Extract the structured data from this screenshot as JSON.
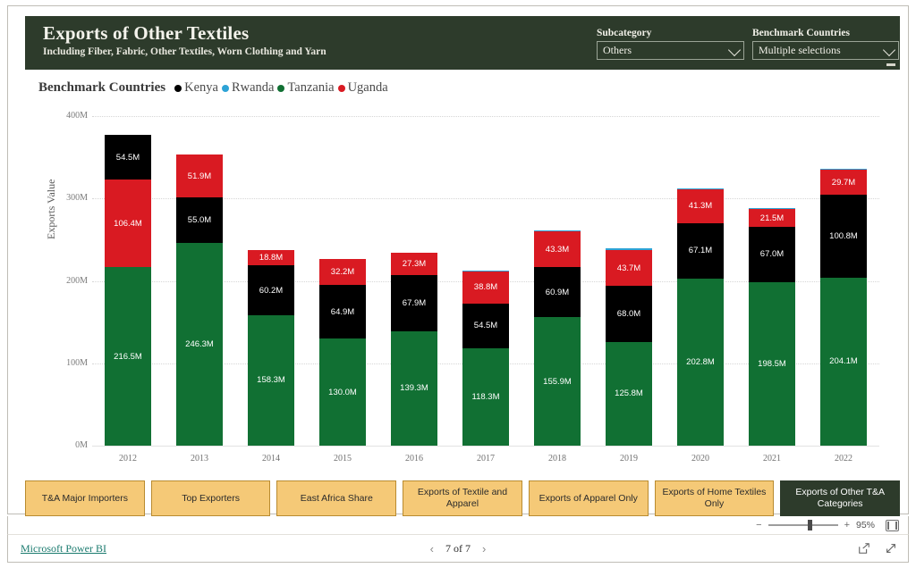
{
  "header": {
    "title": "Exports of Other Textiles",
    "subtitle": "Including Fiber, Fabric, Other Textiles, Worn Clothing and Yarn",
    "background_color": "#2d3b2b",
    "slicers": [
      {
        "label": "Subcategory",
        "value": "Others",
        "chevron": "chevron-down-icon"
      },
      {
        "label": "Benchmark Countries",
        "value": "Multiple selections",
        "chevron": "chevron-down-icon"
      }
    ]
  },
  "legend": {
    "title": "Benchmark Countries",
    "items": [
      {
        "label": "Kenya",
        "color": "#000000"
      },
      {
        "label": "Rwanda",
        "color": "#2da3d6"
      },
      {
        "label": "Tanzania",
        "color": "#117033"
      },
      {
        "label": "Uganda",
        "color": "#d91a22"
      }
    ]
  },
  "chart_data": {
    "type": "bar",
    "stacked": true,
    "title": "Exports of Other Textiles",
    "xlabel": "",
    "ylabel": "Exports Value",
    "ylim": [
      0,
      400
    ],
    "yunit": "M",
    "ytick_labels": [
      "0M",
      "100M",
      "200M",
      "300M",
      "400M"
    ],
    "ytick_values": [
      0,
      100,
      200,
      300,
      400
    ],
    "grid": true,
    "legend_position": "top-left",
    "categories": [
      "2012",
      "2013",
      "2014",
      "2015",
      "2016",
      "2017",
      "2018",
      "2019",
      "2020",
      "2021",
      "2022"
    ],
    "series": [
      {
        "name": "Tanzania",
        "color": "#117033",
        "values": [
          216.5,
          246.3,
          158.3,
          130.0,
          139.3,
          118.3,
          155.9,
          125.8,
          202.8,
          198.5,
          204.1
        ],
        "labels": [
          "216.5M",
          "246.3M",
          "158.3M",
          "130.0M",
          "139.3M",
          "118.3M",
          "155.9M",
          "125.8M",
          "202.8M",
          "198.5M",
          "204.1M"
        ]
      },
      {
        "name": "Kenya",
        "color": "#000000",
        "values": [
          54.5,
          55.0,
          60.2,
          64.9,
          67.9,
          54.5,
          60.9,
          68.0,
          67.1,
          67.0,
          100.8
        ],
        "labels": [
          "54.5M",
          "55.0M",
          "60.2M",
          "64.9M",
          "67.9M",
          "54.5M",
          "60.9M",
          "68.0M",
          "67.1M",
          "67.0M",
          "100.8M"
        ]
      },
      {
        "name": "Uganda",
        "color": "#d91a22",
        "values": [
          106.4,
          51.9,
          18.8,
          32.2,
          27.3,
          38.8,
          43.3,
          43.7,
          41.3,
          21.5,
          29.7
        ],
        "labels": [
          "106.4M",
          "51.9M",
          "18.8M",
          "32.2M",
          "27.3M",
          "38.8M",
          "43.3M",
          "43.7M",
          "41.3M",
          "21.5M",
          "29.7M"
        ]
      },
      {
        "name": "Rwanda",
        "color": "#2da3d6",
        "values": [
          0.0,
          0.0,
          0.0,
          0.0,
          0.0,
          1.4,
          1.6,
          1.7,
          1.3,
          0.9,
          1.0
        ],
        "labels": [
          "",
          "",
          "",
          "",
          "",
          "",
          "",
          "",
          "",
          "",
          ""
        ]
      }
    ],
    "stack_order": [
      [
        "Tanzania",
        "Uganda",
        "Kenya",
        "Rwanda"
      ],
      [
        "Tanzania",
        "Kenya",
        "Uganda",
        "Rwanda"
      ],
      [
        "Tanzania",
        "Kenya",
        "Uganda",
        "Rwanda"
      ],
      [
        "Tanzania",
        "Kenya",
        "Uganda",
        "Rwanda"
      ],
      [
        "Tanzania",
        "Kenya",
        "Uganda",
        "Rwanda"
      ],
      [
        "Tanzania",
        "Kenya",
        "Uganda",
        "Rwanda"
      ],
      [
        "Tanzania",
        "Kenya",
        "Uganda",
        "Rwanda"
      ],
      [
        "Tanzania",
        "Kenya",
        "Uganda",
        "Rwanda"
      ],
      [
        "Tanzania",
        "Kenya",
        "Uganda",
        "Rwanda"
      ],
      [
        "Tanzania",
        "Kenya",
        "Uganda",
        "Rwanda"
      ],
      [
        "Tanzania",
        "Kenya",
        "Uganda",
        "Rwanda"
      ]
    ]
  },
  "nav_buttons": [
    {
      "label": "T&A Major Importers",
      "active": false
    },
    {
      "label": "Top Exporters",
      "active": false
    },
    {
      "label": "East Africa Share",
      "active": false
    },
    {
      "label": "Exports of Textile and Apparel",
      "active": false
    },
    {
      "label": "Exports of Apparel Only",
      "active": false
    },
    {
      "label": "Exports of Home Textiles Only",
      "active": false
    },
    {
      "label": "Exports of Other T&A Categories",
      "active": true
    }
  ],
  "zoombar": {
    "minus": "−",
    "plus": "+",
    "percent": "95%",
    "fit_icon": "fit-to-page-icon"
  },
  "footer": {
    "brand": "Microsoft Power BI",
    "prev": "‹",
    "next": "›",
    "page_text": "7 of 7",
    "share_icon": "share-icon",
    "fullscreen_icon": "fullscreen-icon"
  },
  "colors": {
    "accent_green": "#117033",
    "accent_red": "#d91a22",
    "accent_black": "#000000",
    "accent_blue": "#2da3d6",
    "header_green": "#2d3b2b",
    "button_orange": "#f5c977"
  }
}
